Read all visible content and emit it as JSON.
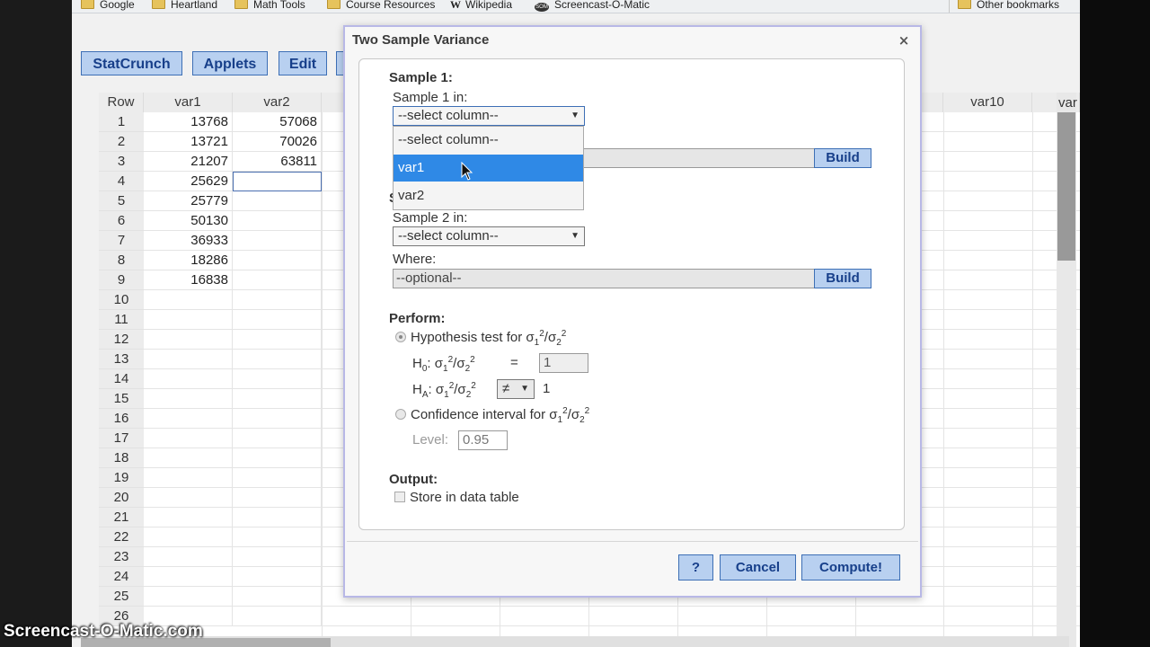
{
  "bookmarks": {
    "items": [
      {
        "label": "Google",
        "icon": "folder-icon"
      },
      {
        "label": "Heartland",
        "icon": "folder-icon"
      },
      {
        "label": "Math Tools",
        "icon": "folder-icon"
      },
      {
        "label": "Course Resources",
        "icon": "folder-icon"
      },
      {
        "label": "Wikipedia",
        "icon": "wikipedia-icon"
      },
      {
        "label": "Screencast-O-Matic",
        "icon": "som-icon"
      }
    ],
    "other": "Other bookmarks",
    "wikipedia_glyph": "W",
    "som_glyph": "SOM"
  },
  "menubar": {
    "statcrunch": "StatCrunch",
    "applets": "Applets",
    "edit": "Edit"
  },
  "grid": {
    "row_header": "Row",
    "columns": [
      "var1",
      "var2"
    ],
    "far_column": "var10",
    "far_column_partial": "var",
    "rows": [
      {
        "n": "1",
        "var1": "13768",
        "var2": "57068"
      },
      {
        "n": "2",
        "var1": "13721",
        "var2": "70026"
      },
      {
        "n": "3",
        "var1": "21207",
        "var2": "63811"
      },
      {
        "n": "4",
        "var1": "25629",
        "var2": ""
      },
      {
        "n": "5",
        "var1": "25779",
        "var2": ""
      },
      {
        "n": "6",
        "var1": "50130",
        "var2": ""
      },
      {
        "n": "7",
        "var1": "36933",
        "var2": ""
      },
      {
        "n": "8",
        "var1": "18286",
        "var2": ""
      },
      {
        "n": "9",
        "var1": "16838",
        "var2": ""
      },
      {
        "n": "10",
        "var1": "",
        "var2": ""
      },
      {
        "n": "11",
        "var1": "",
        "var2": ""
      },
      {
        "n": "12",
        "var1": "",
        "var2": ""
      },
      {
        "n": "13",
        "var1": "",
        "var2": ""
      },
      {
        "n": "14",
        "var1": "",
        "var2": ""
      },
      {
        "n": "15",
        "var1": "",
        "var2": ""
      },
      {
        "n": "16",
        "var1": "",
        "var2": ""
      },
      {
        "n": "17",
        "var1": "",
        "var2": ""
      },
      {
        "n": "18",
        "var1": "",
        "var2": ""
      },
      {
        "n": "19",
        "var1": "",
        "var2": ""
      },
      {
        "n": "20",
        "var1": "",
        "var2": ""
      },
      {
        "n": "21",
        "var1": "",
        "var2": ""
      },
      {
        "n": "22",
        "var1": "",
        "var2": ""
      },
      {
        "n": "23",
        "var1": "",
        "var2": ""
      },
      {
        "n": "24",
        "var1": "",
        "var2": ""
      },
      {
        "n": "25",
        "var1": "",
        "var2": ""
      },
      {
        "n": "26",
        "var1": "",
        "var2": ""
      }
    ]
  },
  "dialog": {
    "title": "Two Sample Variance",
    "close_glyph": "×",
    "sample1": {
      "heading": "Sample 1:",
      "in_label": "Sample 1 in:",
      "select_value": "--select column--",
      "build": "Build",
      "dropdown_options": [
        "--select column--",
        "var1",
        "var2"
      ],
      "highlighted": "var1"
    },
    "sample2": {
      "heading_fragment": "S",
      "in_label": "Sample 2 in:",
      "select_value": "--select column--",
      "where_label": "Where:",
      "where_placeholder": "--optional--",
      "build": "Build"
    },
    "perform": {
      "heading": "Perform:",
      "hypothesis_label": "Hypothesis test for σ",
      "h0_label": "H",
      "h0_sub": "0",
      "ha_sub": "A",
      "equals": "=",
      "h0_value": "1",
      "ha_operator": "≠",
      "ha_value": "1",
      "ci_label": "Confidence interval for σ",
      "level_label": "Level:",
      "level_value": "0.95",
      "sigma": "σ",
      "one": "1",
      "two": "2",
      "slash": "/",
      "colon": ": "
    },
    "output": {
      "heading": "Output:",
      "store_label": "Store in data table"
    },
    "buttons": {
      "help": "?",
      "cancel": "Cancel",
      "compute": "Compute!"
    }
  },
  "watermark": "Screencast-O-Matic.com",
  "select_arrow": "▼"
}
